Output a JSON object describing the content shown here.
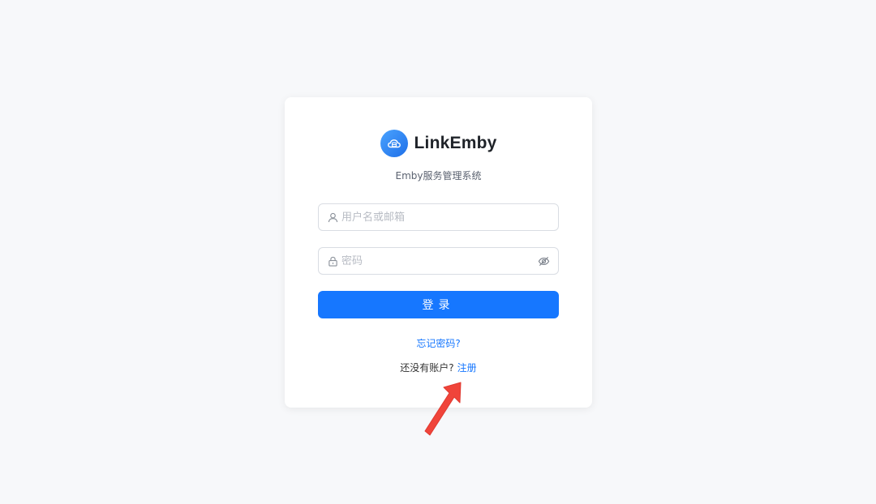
{
  "brand": {
    "name": "LinkEmby",
    "subtitle": "Emby服务管理系统",
    "logo_icon": "cloud-server-icon",
    "accent_color": "#1677ff"
  },
  "form": {
    "username": {
      "placeholder": "用户名或邮箱",
      "value": "",
      "icon": "user-icon"
    },
    "password": {
      "placeholder": "密码",
      "value": "",
      "icon": "lock-icon",
      "toggle_icon": "eye-off-icon"
    },
    "login_label": "登录",
    "forgot_label": "忘记密码?",
    "no_account_label": "还没有账户?",
    "register_label": "注册"
  },
  "annotation": {
    "icon": "red-arrow-icon",
    "color": "#f0443a"
  }
}
